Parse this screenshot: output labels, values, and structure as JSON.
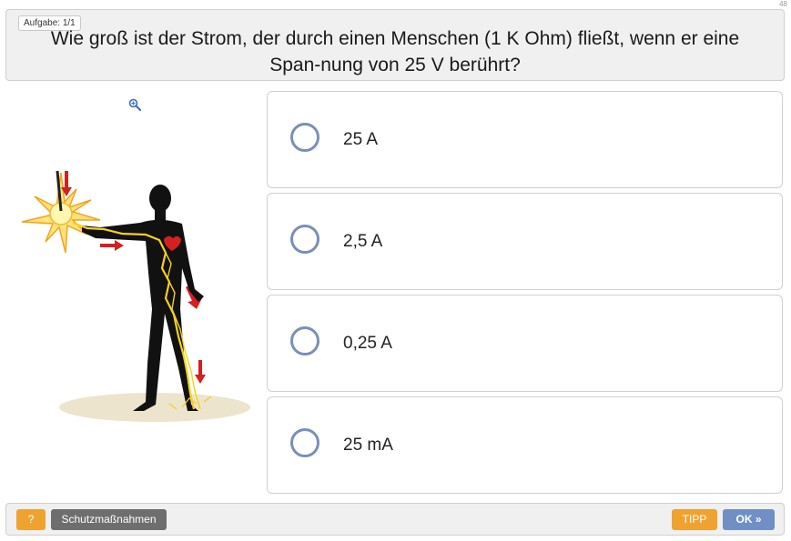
{
  "page_number": "48",
  "question": {
    "task_label": "Aufgabe: 1/1",
    "text": "Wie groß ist der Strom, der durch einen Menschen (1 K Ohm) fließt, wenn er eine Span-nung von 25 V berührt?"
  },
  "answers": [
    {
      "label": "25 A"
    },
    {
      "label": "2,5 A"
    },
    {
      "label": "0,25 A"
    },
    {
      "label": "25 mA"
    }
  ],
  "footer": {
    "help_label": "?",
    "measures_label": "Schutzmaßnahmen",
    "tip_label": "TIPP",
    "ok_label": "OK »"
  },
  "colors": {
    "radio_border": "#7a8fb8",
    "tip_button": "#f0a230",
    "ok_button": "#6f8fc5",
    "secondary_button": "#6e6e6e"
  },
  "icons": [
    "zoom-icon",
    "radio-icon"
  ]
}
